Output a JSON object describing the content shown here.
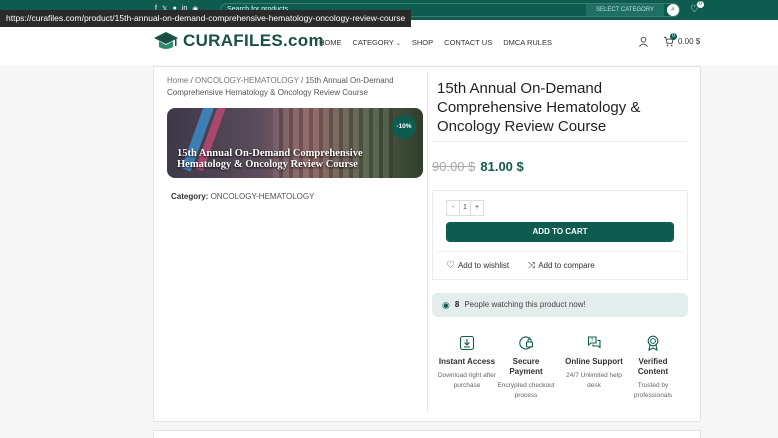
{
  "status_url": "https://curafiles.com/product/15th-annual-on-demand-comprehensive-hematology-oncology-review-course",
  "topbar": {
    "search_placeholder": "Search for products",
    "search_button": "SELECT CATEGORY",
    "wishlist_count": "0"
  },
  "header": {
    "logo_text": "CURAFILES.com",
    "nav": [
      "HOME",
      "CATEGORY",
      "SHOP",
      "CONTACT US",
      "DMCA RULES"
    ],
    "cart_count": "0",
    "cart_total": "0.00 $"
  },
  "breadcrumb": {
    "home": "Home",
    "sep1": "/",
    "category": "ONCOLOGY-HEMATOLOGY",
    "sep2": "/",
    "current": "15th Annual On-Demand Comprehensive Hematology & Oncology Review Course"
  },
  "banner": {
    "title": "15th Annual On-Demand Comprehensive Hematology & Oncology Review Course",
    "sale_badge": "-10%"
  },
  "category": {
    "label": "Category:",
    "value": "ONCOLOGY-HEMATOLOGY"
  },
  "product": {
    "title": "15th Annual On-Demand Comprehensive Hematology & Oncology Review Course",
    "old_price": "90.00 $",
    "new_price": "81.00 $",
    "qty_minus": "-",
    "qty": "1",
    "qty_plus": "+",
    "add_to_cart": "ADD TO CART",
    "wishlist": "Add to wishlist",
    "compare": "Add to compare",
    "watching_count": "8",
    "watching_text": "People watching this product now!"
  },
  "features": [
    {
      "icon": "download-icon",
      "title": "Instant Access",
      "desc": "Download right after purchase"
    },
    {
      "icon": "secure-payment-icon",
      "title": "Secure Payment",
      "desc": "Encrypted checkout process"
    },
    {
      "icon": "support-icon",
      "title": "Online Support",
      "desc": "24/7 Unlimited help desk"
    },
    {
      "icon": "verified-icon",
      "title": "Verified Content",
      "desc": "Trusted by professionals"
    }
  ],
  "colors": {
    "brand": "#0e5c4f",
    "watching_bg": "#e3eeec"
  }
}
